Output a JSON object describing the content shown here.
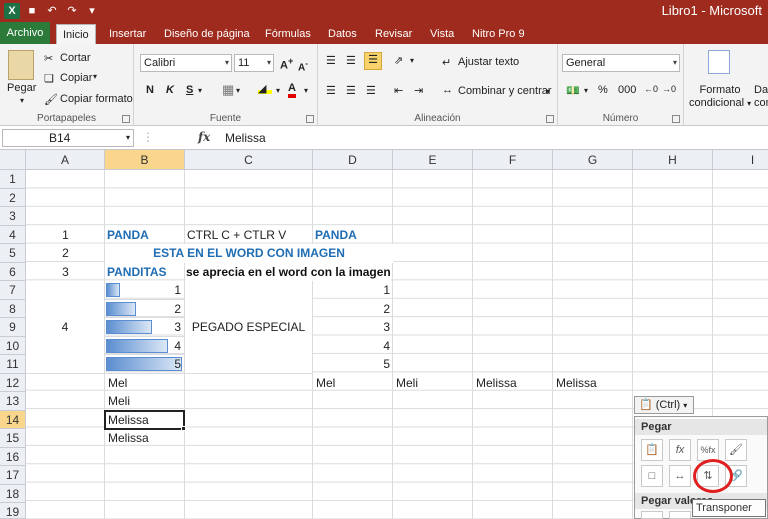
{
  "window": {
    "title": "Libro1 - Microsoft"
  },
  "quick_access": {
    "logo": "X",
    "undo": "↶",
    "redo": "↷"
  },
  "tabs": [
    {
      "label": "Archivo"
    },
    {
      "label": "Inicio"
    },
    {
      "label": "Insertar"
    },
    {
      "label": "Diseño de página"
    },
    {
      "label": "Fórmulas"
    },
    {
      "label": "Datos"
    },
    {
      "label": "Revisar"
    },
    {
      "label": "Vista"
    },
    {
      "label": "Nitro Pro 9"
    }
  ],
  "ribbon": {
    "clipboard": {
      "paste": "Pegar",
      "cut": "Cortar",
      "copy": "Copiar",
      "format_painter": "Copiar formato",
      "label": "Portapapeles"
    },
    "font": {
      "name": "Calibri",
      "size": "11",
      "bold": "N",
      "italic": "K",
      "underline": "S",
      "label": "Fuente"
    },
    "alignment": {
      "wrap": "Ajustar texto",
      "merge": "Combinar y centrar",
      "label": "Alineación"
    },
    "number": {
      "format": "General",
      "percent": "%",
      "thousands": "000",
      "label": "Número"
    },
    "styles": {
      "conditional": "Formato condicional",
      "conditional_line1": "Formato",
      "conditional_line2": "condicional",
      "next": "Da",
      "next2": "com"
    }
  },
  "formula_bar": {
    "name_box": "B14",
    "fx": "fx",
    "value": "Melissa"
  },
  "columns": [
    "A",
    "B",
    "C",
    "D",
    "E",
    "F",
    "G",
    "H",
    "I"
  ],
  "rows": [
    "1",
    "2",
    "3",
    "4",
    "5",
    "6",
    "7",
    "8",
    "9",
    "10",
    "11",
    "12",
    "13",
    "14",
    "15",
    "16",
    "17",
    "18",
    "19"
  ],
  "cells": {
    "a4": "1",
    "b4": "PANDA",
    "c4": "CTRL C + CTLR V",
    "d4": "PANDA",
    "a5": "2",
    "bc5": "ESTA EN EL WORD CON IMAGEN",
    "a6": "3",
    "b6": "PANDITAS",
    "c6": "se aprecia en el word con la imagen",
    "b7": "1",
    "b8": "2",
    "b9": "3",
    "b10": "4",
    "b11": "5",
    "a9": "4",
    "c9": "PEGADO ESPECIAL",
    "d7": "1",
    "d8": "2",
    "d9": "3",
    "d10": "4",
    "d11": "5",
    "b12": "Mel",
    "d12": "Mel",
    "e12": "Meli",
    "f12": "Melissa",
    "g12": "Melissa",
    "b13": "Meli",
    "b14": "Melissa",
    "b15": "Melissa"
  },
  "databars": [
    0.2,
    0.4,
    0.6,
    0.8,
    1.0
  ],
  "paste_options": {
    "button": "(Ctrl)",
    "section_paste": "Pegar",
    "section_values": "Pegar valores",
    "tooltip": "Transponer (T)"
  },
  "colors": {
    "title_bar": "#9e2b1d",
    "file_tab": "#2b7a3a",
    "selected_header": "#f9d68b",
    "blue_text": "#1f6db3",
    "highlight_circle": "#e02020"
  }
}
